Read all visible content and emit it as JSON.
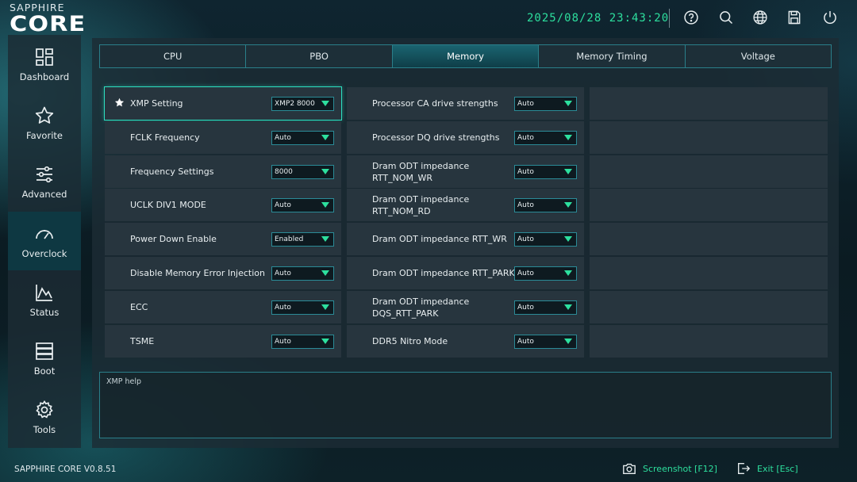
{
  "header": {
    "brand_top": "SAPPHIRE",
    "brand_main": "CORE",
    "datetime": "2025/08/28 23:43:20",
    "icons": [
      "help-icon",
      "search-icon",
      "globe-icon",
      "save-icon",
      "power-icon"
    ]
  },
  "sidebar": {
    "items": [
      {
        "label": "Dashboard",
        "icon": "dashboard-icon"
      },
      {
        "label": "Favorite",
        "icon": "star-icon"
      },
      {
        "label": "Advanced",
        "icon": "sliders-icon"
      },
      {
        "label": "Overclock",
        "icon": "gauge-icon",
        "active": true
      },
      {
        "label": "Status",
        "icon": "chart-icon"
      },
      {
        "label": "Boot",
        "icon": "boot-icon"
      },
      {
        "label": "Tools",
        "icon": "gear-icon"
      }
    ]
  },
  "tabs": [
    {
      "label": "CPU"
    },
    {
      "label": "PBO"
    },
    {
      "label": "Memory",
      "active": true
    },
    {
      "label": "Memory Timing"
    },
    {
      "label": "Voltage"
    }
  ],
  "left_settings": [
    {
      "label": "XMP Setting",
      "value": "XMP2 8000",
      "favorite": true,
      "selected": true
    },
    {
      "label": "FCLK Frequency",
      "value": "Auto"
    },
    {
      "label": "Frequency Settings",
      "value": "8000"
    },
    {
      "label": "UCLK DIV1 MODE",
      "value": "Auto"
    },
    {
      "label": "Power Down Enable",
      "value": "Enabled"
    },
    {
      "label": "Disable Memory Error Injection",
      "value": "Auto"
    },
    {
      "label": "ECC",
      "value": "Auto"
    },
    {
      "label": "TSME",
      "value": "Auto"
    }
  ],
  "right_settings": [
    {
      "label_line1": "Processor CA drive strengths",
      "label_line2": "",
      "value": "Auto"
    },
    {
      "label_line1": "Processor DQ drive strengths",
      "label_line2": "",
      "value": "Auto"
    },
    {
      "label_line1": "Dram ODT impedance",
      "label_line2": "RTT_NOM_WR",
      "value": "Auto"
    },
    {
      "label_line1": "Dram ODT impedance",
      "label_line2": "RTT_NOM_RD",
      "value": "Auto"
    },
    {
      "label_line1": "Dram ODT impedance RTT_WR",
      "label_line2": "",
      "value": "Auto"
    },
    {
      "label_line1": "Dram ODT impedance RTT_PARK",
      "label_line2": "",
      "value": "Auto"
    },
    {
      "label_line1": "Dram ODT impedance",
      "label_line2": "DQS_RTT_PARK",
      "value": "Auto"
    },
    {
      "label_line1": "DDR5 Nitro Mode",
      "label_line2": "",
      "value": "Auto"
    }
  ],
  "help": {
    "title": "XMP help"
  },
  "footer": {
    "version": "SAPPHIRE CORE V0.8.51",
    "screenshot_label": "Screenshot [F12]",
    "exit_label": "Exit [Esc]"
  },
  "colors": {
    "accent": "#2ddf9e",
    "border": "#2a7f8a",
    "row_bg": "#27353e"
  }
}
